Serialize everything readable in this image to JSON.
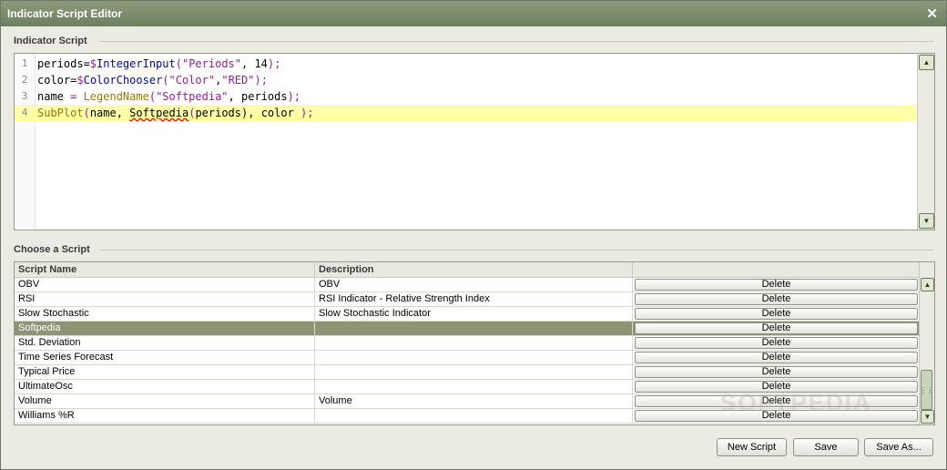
{
  "window": {
    "title": "Indicator Script Editor",
    "close_glyph": "✕"
  },
  "script_section": {
    "label": "Indicator Script"
  },
  "editor": {
    "lines": [
      {
        "num": "1",
        "parts": [
          {
            "t": "periods=",
            "c": ""
          },
          {
            "t": "$",
            "c": "op"
          },
          {
            "t": "IntegerInput",
            "c": "fn"
          },
          {
            "t": "(",
            "c": "op"
          },
          {
            "t": "\"Periods\"",
            "c": "str"
          },
          {
            "t": ", 14",
            "c": ""
          },
          {
            "t": ");",
            "c": "op"
          }
        ]
      },
      {
        "num": "2",
        "parts": [
          {
            "t": "color=",
            "c": ""
          },
          {
            "t": "$",
            "c": "op"
          },
          {
            "t": "ColorChooser",
            "c": "fn"
          },
          {
            "t": "(",
            "c": "op"
          },
          {
            "t": "\"Color\"",
            "c": "str"
          },
          {
            "t": ",",
            "c": ""
          },
          {
            "t": "\"RED\"",
            "c": "str"
          },
          {
            "t": ");",
            "c": "op"
          }
        ]
      },
      {
        "num": "3",
        "parts": [
          {
            "t": "name ",
            "c": ""
          },
          {
            "t": "= ",
            "c": "op"
          },
          {
            "t": "LegendName",
            "c": "hlcode"
          },
          {
            "t": "(",
            "c": "op"
          },
          {
            "t": "\"Softpedia\"",
            "c": "str"
          },
          {
            "t": ", periods",
            "c": ""
          },
          {
            "t": ");",
            "c": "op"
          }
        ]
      },
      {
        "num": "4",
        "parts": [
          {
            "t": "SubPlot",
            "c": "hlcode"
          },
          {
            "t": "(",
            "c": "op"
          },
          {
            "t": "name, ",
            "c": ""
          },
          {
            "t": "Softpedia",
            "c": "wavy"
          },
          {
            "t": "(",
            "c": "op"
          },
          {
            "t": "periods",
            "c": ""
          },
          {
            "t": "), color ",
            "c": ""
          },
          {
            "t": ");",
            "c": "op"
          }
        ]
      }
    ],
    "highlighted_line": 4,
    "scroll_up_glyph": "▲",
    "scroll_down_glyph": "▼"
  },
  "choose_section": {
    "label": "Choose a Script"
  },
  "table": {
    "columns": [
      "Script Name",
      "Description",
      ""
    ],
    "delete_label": "Delete",
    "rows": [
      {
        "name": "OBV",
        "description": "OBV"
      },
      {
        "name": "RSI",
        "description": "RSI Indicator - Relative Strength Index"
      },
      {
        "name": "Slow Stochastic",
        "description": "Slow Stochastic Indicator"
      },
      {
        "name": "Softpedia",
        "description": ""
      },
      {
        "name": "Std. Deviation",
        "description": ""
      },
      {
        "name": "Time Series Forecast",
        "description": ""
      },
      {
        "name": "Typical Price",
        "description": ""
      },
      {
        "name": "UltimateOsc",
        "description": ""
      },
      {
        "name": "Volume",
        "description": "Volume"
      },
      {
        "name": "Williams %R",
        "description": ""
      }
    ],
    "selected_row": 3,
    "thumb_grip": "⋮⋮"
  },
  "buttons": {
    "new_script": "New Script",
    "save": "Save",
    "save_as": "Save As..."
  },
  "watermark": "SOFTPEDIA"
}
